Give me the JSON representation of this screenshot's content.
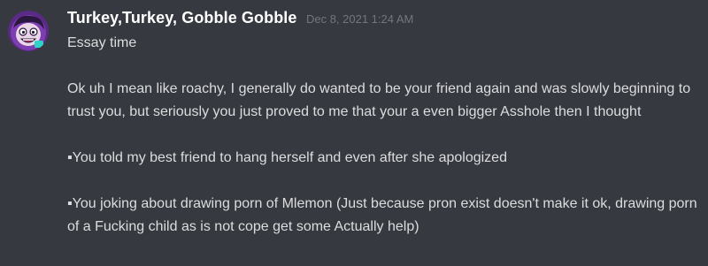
{
  "message": {
    "author": "Turkey,Turkey, Gobble Gobble",
    "timestamp": "Dec 8, 2021 1:24 AM",
    "lines": [
      "Essay time",
      "Ok uh I mean like roachy, I generally do wanted to be your friend again and was slowly beginning to trust you, but seriously you just proved to me that your a even bigger Asshole then I thought",
      "▪You told my best friend to hang herself and even after she apologized",
      "▪You joking about drawing porn of Mlemon (Just because pron exist doesn't make it ok, drawing porn of a Fucking child as is not cope get some Actually help)"
    ]
  },
  "colors": {
    "background": "#36393f",
    "username": "#ffffff",
    "text": "#dcddde",
    "timestamp": "#72767d"
  },
  "icons": {
    "avatar": "user-avatar-cartoon"
  }
}
